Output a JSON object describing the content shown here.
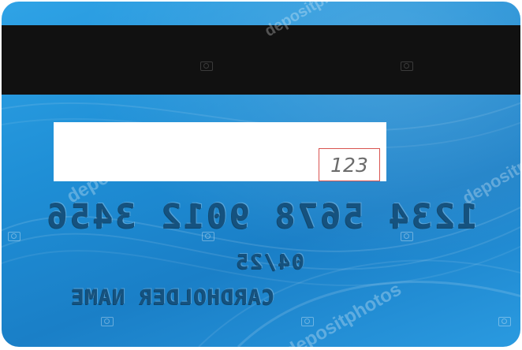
{
  "card": {
    "cvv": "123",
    "number": "1234 5678 9012 3456",
    "expiry": "04/25",
    "holder_name": "CARDHOLDER NAME"
  },
  "watermark": {
    "text": "depositphotos"
  },
  "colors": {
    "card_blue": "#1f8fd6",
    "stripe": "#111111",
    "emboss": "#15527f",
    "cvv_border": "#d9534f"
  },
  "icons": [
    "camera-icon"
  ]
}
